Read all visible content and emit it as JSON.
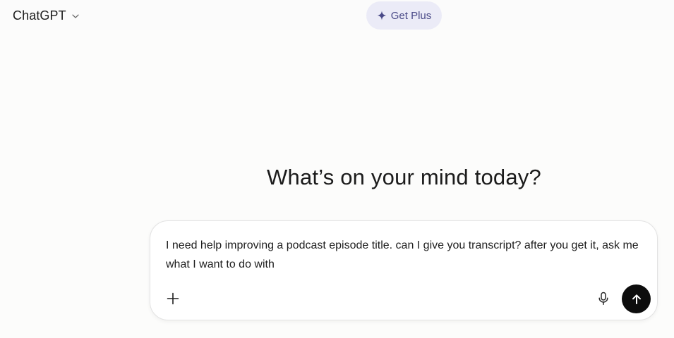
{
  "header": {
    "model_name": "ChatGPT",
    "model_icon": "chevron-down-icon",
    "upgrade_label": "Get Plus",
    "upgrade_icon": "sparkle-icon",
    "upgrade_accent": "#4a4a88",
    "upgrade_bg": "#ebebf7"
  },
  "main": {
    "headline": "What’s on your mind today?"
  },
  "composer": {
    "prompt_text": "I need help improving a podcast episode title. can I give you transcript? after you get it, ask me what I want to do with",
    "attach_icon": "plus-icon",
    "voice_icon": "microphone-icon",
    "send_icon": "arrow-up-icon"
  }
}
